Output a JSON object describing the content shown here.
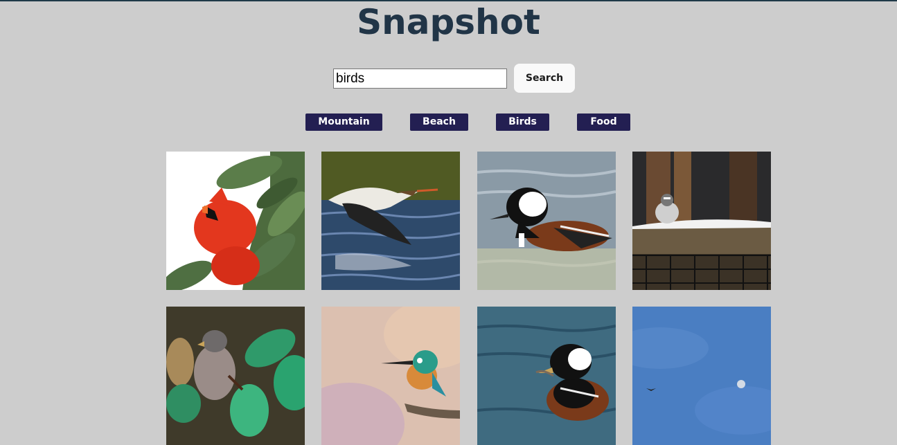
{
  "header": {
    "title": "Snapshot"
  },
  "search": {
    "value": "birds",
    "button_label": "Search"
  },
  "categories": [
    {
      "label": "Mountain"
    },
    {
      "label": "Beach"
    },
    {
      "label": "Birds"
    },
    {
      "label": "Food"
    }
  ],
  "gallery": {
    "images": [
      {
        "subject": "northern-cardinal"
      },
      {
        "subject": "merganser-in-flight"
      },
      {
        "subject": "hooded-merganser"
      },
      {
        "subject": "sparrow-on-snowy-fence"
      },
      {
        "subject": "sparrow-in-leaves"
      },
      {
        "subject": "kingfisher-on-branch"
      },
      {
        "subject": "hooded-merganser-with-catch"
      },
      {
        "subject": "bird-in-blue-sky-with-moon"
      }
    ]
  },
  "colors": {
    "background": "#cdcdcd",
    "title": "#213547",
    "category_button": "#231f52",
    "search_button": "#f9f9f9"
  }
}
